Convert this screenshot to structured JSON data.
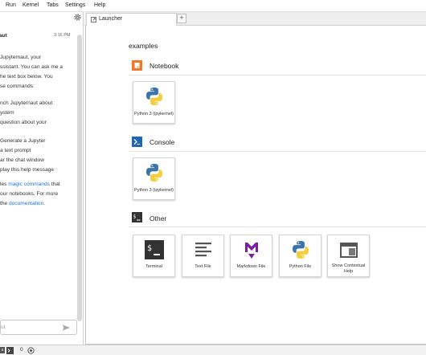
{
  "menubar": {
    "items": [
      "Run",
      "Kernel",
      "Tabs",
      "Settings",
      "Help"
    ]
  },
  "chat": {
    "author": "aut",
    "time": "3:16 PM",
    "lines": [
      "Jupyternaut, your",
      "ssistant. You can ask me a",
      "he text box below. You",
      "se commands:",
      "nch Jupyternaut about",
      "ystem",
      " question about your",
      "Generate a Jupyter",
      " a text prompt",
      "ar the chat window",
      "play this help message"
    ],
    "para_prefix": "les ",
    "link_magic": "magic commands",
    "para_mid": " that",
    "para_line2": "our notebooks. For more",
    "para_line3_prefix": " the ",
    "link_docs": "documentation",
    "para_end": ".",
    "input_placeholder": "ut"
  },
  "tabs": [
    {
      "label": "Launcher"
    }
  ],
  "add_tab_label": "+",
  "launcher": {
    "directory": "examples",
    "sections": [
      {
        "title": "Notebook",
        "icon": "notebook-icon"
      },
      {
        "title": "Console",
        "icon": "console-icon"
      },
      {
        "title": "Other",
        "icon": "terminal-section-icon"
      }
    ],
    "notebook_cards": [
      {
        "label": "Python 3 (ipykernel)",
        "icon": "python-logo-icon"
      }
    ],
    "console_cards": [
      {
        "label": "Python 3 (ipykernel)",
        "icon": "python-logo-icon"
      }
    ],
    "other_cards": [
      {
        "label": "Terminal",
        "icon": "terminal-icon"
      },
      {
        "label": "Text File",
        "icon": "text-file-icon"
      },
      {
        "label": "Markdown File",
        "icon": "markdown-icon"
      },
      {
        "label": "Python File",
        "icon": "python-logo-icon"
      },
      {
        "label": "Show Contextual Help",
        "icon": "contextual-help-icon"
      }
    ]
  },
  "status": {
    "prefix": "s",
    "count": "0"
  },
  "colors": {
    "notebook": "#f37726",
    "console": "#1f67b5",
    "markdown": "#7b1fa2",
    "link": "#1a73e8"
  }
}
